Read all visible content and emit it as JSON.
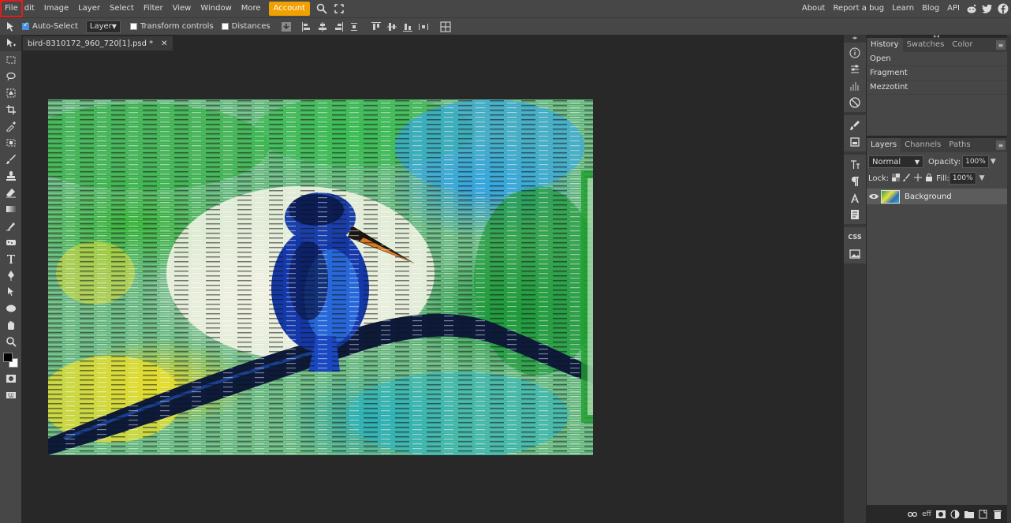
{
  "menubar": {
    "items": [
      "File",
      "dit",
      "Image",
      "Layer",
      "Select",
      "Filter",
      "View",
      "Window",
      "More"
    ],
    "account": "Account",
    "right_items": [
      "About",
      "Report a bug",
      "Learn",
      "Blog",
      "API"
    ]
  },
  "options": {
    "auto_select_label": "Auto-Select",
    "layer_select": "Layer",
    "transform_label": "Transform controls",
    "distances_label": "Distances"
  },
  "document": {
    "tab_title": "bird-8310172_960_720[1].psd *",
    "close": "✕"
  },
  "history": {
    "tabs": [
      "History",
      "Swatches",
      "Color"
    ],
    "items": [
      "Open",
      "Fragment",
      "Mezzotint"
    ]
  },
  "layers": {
    "tabs": [
      "Layers",
      "Channels",
      "Paths"
    ],
    "blend_mode": "Normal",
    "opacity_label": "Opacity:",
    "opacity_value": "100%",
    "lock_label": "Lock:",
    "fill_label": "Fill:",
    "fill_value": "100%",
    "layer_name": "Background"
  },
  "minibar": {
    "css_label": "CSS"
  },
  "footer": {
    "eff_label": "eff"
  },
  "colors": {
    "foreground": "#000000",
    "background": "#ffffff",
    "accent": "#f0a000",
    "highlight": "#e01e1e"
  }
}
